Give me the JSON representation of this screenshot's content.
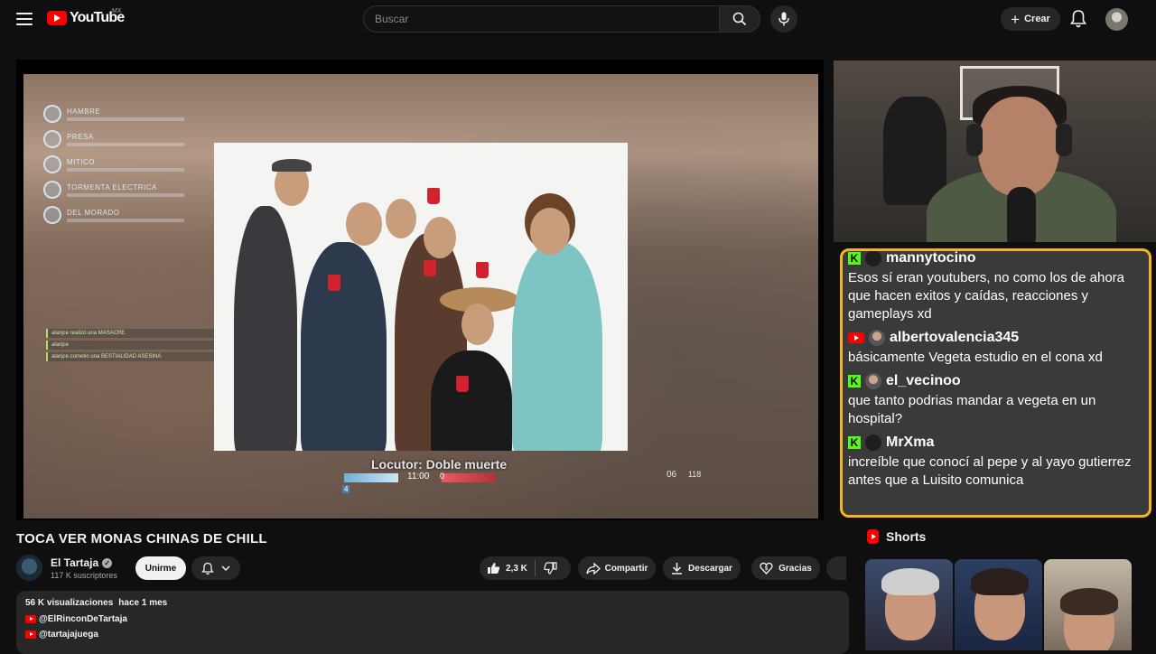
{
  "header": {
    "logo_text": "YouTube",
    "country": "MX",
    "search_placeholder": "Buscar",
    "create_label": "Crear"
  },
  "game": {
    "hud_items": [
      "HAMBRE",
      "PRESA",
      "MITICO",
      "TORMENTA ELECTRICA",
      "DEL MORADO"
    ],
    "time": "11:00",
    "score_left": "4",
    "score_right": "0",
    "ammo": "06",
    "ammo_reserve": "118",
    "caption": "Locutor: Doble muerte",
    "kill_feed": [
      "alanjce realizó una MASACRE",
      "alanjce",
      "alanjce cometió una BESTIALIDAD ASESINA"
    ]
  },
  "chat": {
    "messages": [
      {
        "platform": "kick",
        "user": "mannytocino",
        "text": "Esos sí eran youtubers, no como los de ahora que hacen exitos y caídas, reacciones y gameplays xd"
      },
      {
        "platform": "youtube",
        "user": "albertovalencia345",
        "text": "básicamente Vegeta estudio en el cona xd"
      },
      {
        "platform": "kick",
        "user": "el_vecinoo",
        "text": "que tanto podrias mandar a vegeta en un hospital?"
      },
      {
        "platform": "kick",
        "user": "MrXma",
        "text": "increíble que conocí al pepe y al yayo gutierrez antes que a Luisito comunica"
      }
    ]
  },
  "video": {
    "title": "TOCA VER MONAS CHINAS DE CHILL",
    "channel_name": "El Tartaja",
    "subscribers": "117 K suscriptores",
    "join_label": "Unirme",
    "likes": "2,3 K",
    "share_label": "Compartir",
    "download_label": "Descargar",
    "thanks_label": "Gracias"
  },
  "description": {
    "views": "56 K visualizaciones",
    "date": "hace 1 mes",
    "links": [
      "@ElRinconDeTartaja",
      "@tartajajuega"
    ]
  },
  "shorts": {
    "label": "Shorts"
  },
  "colors": {
    "chat_border": "#f4b423",
    "kick_green": "#53fc18",
    "youtube_red": "#ff0000"
  }
}
